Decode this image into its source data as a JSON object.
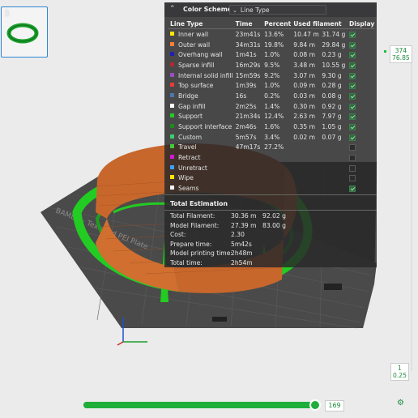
{
  "plate": {
    "number": "1"
  },
  "legend": {
    "title": "Color Scheme",
    "view_mode": "Line Type",
    "columns": [
      "Line Type",
      "Time",
      "Percent",
      "Used filament",
      "",
      "Display"
    ],
    "rows": [
      {
        "name": "Inner wall",
        "color": "#ffe600",
        "time": "23m41s",
        "percent": "13.6%",
        "len": "10.47 m",
        "weight": "31.74 g",
        "display": true
      },
      {
        "name": "Outer wall",
        "color": "#ff7d38",
        "time": "34m31s",
        "percent": "19.8%",
        "len": "9.84 m",
        "weight": "29.84 g",
        "display": true
      },
      {
        "name": "Overhang wall",
        "color": "#1f1fb6",
        "time": "1m41s",
        "percent": "1.0%",
        "len": "0.08 m",
        "weight": "0.23 g",
        "display": true
      },
      {
        "name": "Sparse infill",
        "color": "#b3272e",
        "time": "16m29s",
        "percent": "9.5%",
        "len": "3.48 m",
        "weight": "10.55 g",
        "display": true
      },
      {
        "name": "Internal solid infill",
        "color": "#9a4cc2",
        "time": "15m59s",
        "percent": "9.2%",
        "len": "3.07 m",
        "weight": "9.30 g",
        "display": true
      },
      {
        "name": "Top surface",
        "color": "#e63b3b",
        "time": "1m39s",
        "percent": "1.0%",
        "len": "0.09 m",
        "weight": "0.28 g",
        "display": true
      },
      {
        "name": "Bridge",
        "color": "#4a79b0",
        "time": "16s",
        "percent": "0.2%",
        "len": "0.03 m",
        "weight": "0.08 g",
        "display": true
      },
      {
        "name": "Gap infill",
        "color": "#ffffff",
        "time": "2m25s",
        "percent": "1.4%",
        "len": "0.30 m",
        "weight": "0.92 g",
        "display": true
      },
      {
        "name": "Support",
        "color": "#22cc22",
        "time": "21m34s",
        "percent": "12.4%",
        "len": "2.63 m",
        "weight": "7.97 g",
        "display": true
      },
      {
        "name": "Support interface",
        "color": "#1e8a1e",
        "time": "2m46s",
        "percent": "1.6%",
        "len": "0.35 m",
        "weight": "1.05 g",
        "display": true
      },
      {
        "name": "Custom",
        "color": "#3bcf6a",
        "time": "5m57s",
        "percent": "3.4%",
        "len": "0.02 m",
        "weight": "0.07 g",
        "display": true
      },
      {
        "name": "Travel",
        "color": "#44c83b",
        "time": "47m17s",
        "percent": "27.2%",
        "len": "",
        "weight": "",
        "display": false
      },
      {
        "name": "Retract",
        "color": "#d11ad1",
        "time": "",
        "percent": "",
        "len": "",
        "weight": "",
        "display": false
      },
      {
        "name": "Unretract",
        "color": "#3ea0ff",
        "time": "",
        "percent": "",
        "len": "",
        "weight": "",
        "display": false
      },
      {
        "name": "Wipe",
        "color": "#ffe600",
        "time": "",
        "percent": "",
        "len": "",
        "weight": "",
        "display": false
      },
      {
        "name": "Seams",
        "color": "#f2f2f2",
        "time": "",
        "percent": "",
        "len": "",
        "weight": "",
        "display": true
      }
    ],
    "estimation": {
      "title": "Total Estimation",
      "lines": [
        {
          "label": "Total Filament:",
          "v1": "30.36 m",
          "v2": "92.02 g"
        },
        {
          "label": "Model Filament:",
          "v1": "27.39 m",
          "v2": "83.00 g"
        },
        {
          "label": "Cost:",
          "v1": "2.30",
          "v2": ""
        },
        {
          "label": "Prepare time:",
          "v1": "5m42s",
          "v2": ""
        },
        {
          "label": "Model printing time:",
          "v1": "2h48m",
          "v2": ""
        },
        {
          "label": "Total time:",
          "v1": "2h54m",
          "v2": ""
        }
      ]
    }
  },
  "layer_slider": {
    "top_layer": "374",
    "top_height": "76.85",
    "bottom_layer": "1",
    "bottom_height": "0.25"
  },
  "move_slider": {
    "value": "169"
  },
  "colors": {
    "support": "#22cc22",
    "outer_wall": "#c8672c",
    "accent": "#1fae3a"
  }
}
